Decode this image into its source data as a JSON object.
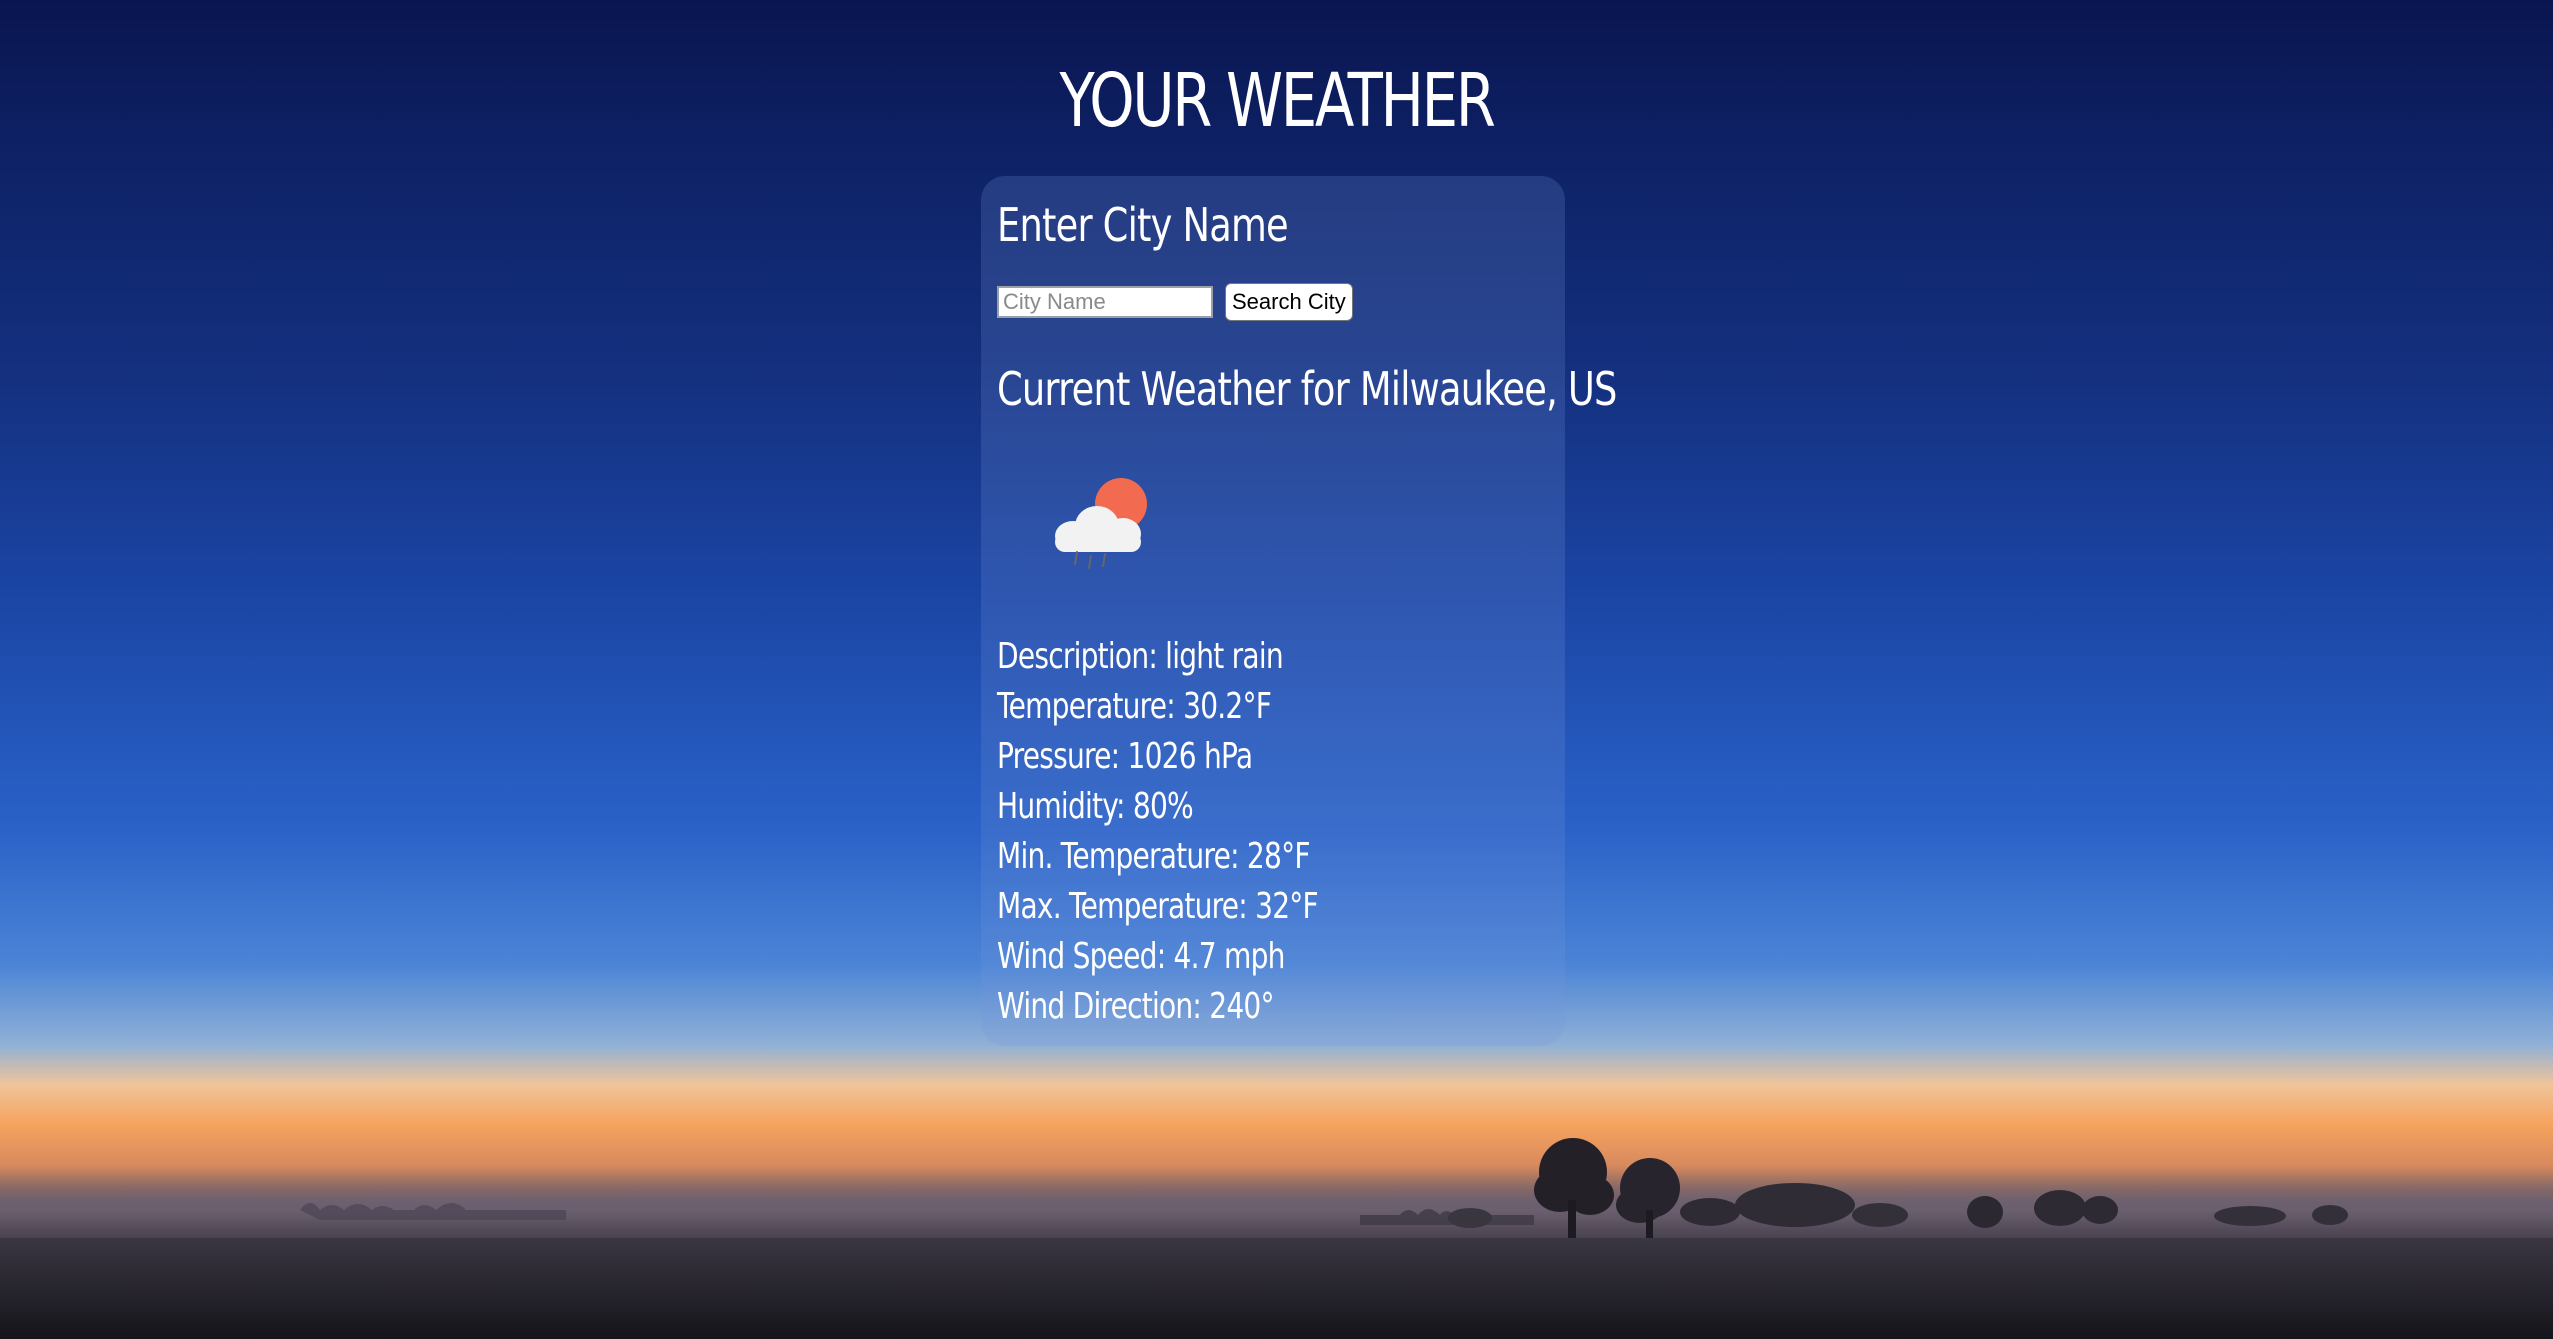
{
  "page": {
    "title": "YOUR WEATHER"
  },
  "search": {
    "heading": "Enter City Name",
    "placeholder": "City Name",
    "value": "",
    "button_label": "Search City"
  },
  "current": {
    "heading": "Current Weather for Milwaukee, US",
    "icon": "cloud-sun-rain-icon",
    "details": [
      "Description: light rain",
      "Temperature: 30.2°F",
      "Pressure: 1026 hPa",
      "Humidity: 80%",
      "Min. Temperature: 28°F",
      "Max. Temperature: 32°F",
      "Wind Speed: 4.7 mph",
      "Wind Direction: 240°"
    ]
  },
  "colors": {
    "text": "#ffffff",
    "sun": "#f26a4f",
    "cloud": "#f2f2f2",
    "card_tint": "rgba(120,150,220,0.22)"
  }
}
